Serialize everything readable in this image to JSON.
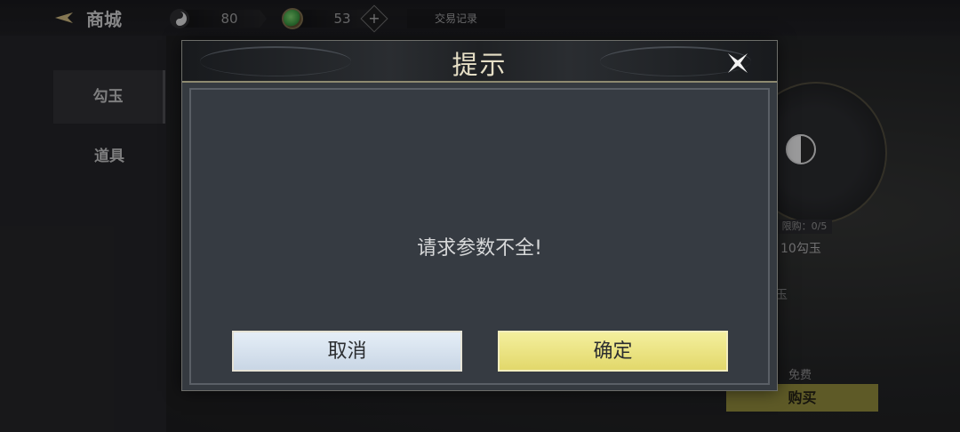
{
  "header": {
    "title": "商城",
    "currencies": [
      {
        "icon": "yinyang-icon",
        "value": "80"
      },
      {
        "icon": "jade-icon",
        "value": "53"
      }
    ],
    "trade_record": "交易记录"
  },
  "sidebar": {
    "items": [
      {
        "label": "勾玉",
        "active": true
      },
      {
        "label": "道具",
        "active": false
      }
    ]
  },
  "item_panel": {
    "limit": "限购：0/5",
    "price": "10勾玉",
    "partial": "玉",
    "free": "免费",
    "buy_label": "购买"
  },
  "dialog": {
    "title": "提示",
    "message": "请求参数不全!",
    "cancel_label": "取消",
    "confirm_label": "确定"
  },
  "colors": {
    "confirm": "#e2d86b",
    "cancel": "#c9d6e5",
    "buy": "#8c8637"
  }
}
